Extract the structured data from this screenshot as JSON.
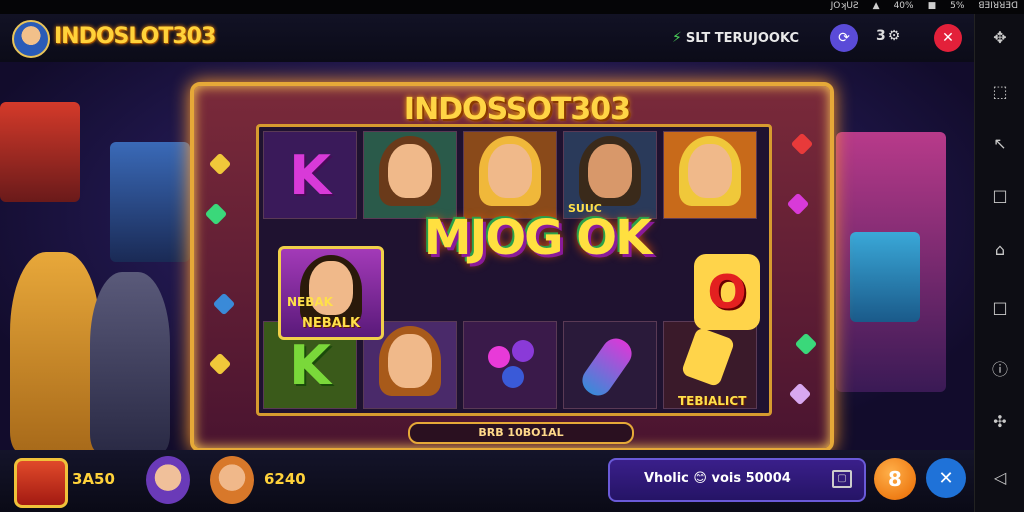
{
  "status_bar": {
    "items": [
      "JOʞUƧ",
      "▲",
      "40%",
      "■",
      "5%",
      "ꓭƎIꓤꓤƎꓷ"
    ]
  },
  "header": {
    "brand": "INDOSLOT303",
    "status_text": "SLT TERUJOOKC",
    "gear_count": "3"
  },
  "game": {
    "frame_title": "INDOSSOT303",
    "win_text": "MJOG OK",
    "wild_label": "NEBALK",
    "wild_sub": "NEBAK",
    "o_symbol": "O",
    "k_symbol": "K",
    "bonus_label": "TEBIALICT",
    "bottom_text": "BRB 10BO1AL",
    "badge_text": "SUUC"
  },
  "bottom": {
    "value_1": "3A50",
    "value_2": "6240",
    "wallet_text": "Vholic 😊 vois 50004",
    "coin_label": "8",
    "close_label": "✕"
  },
  "side_panel": {
    "icons": [
      "scatter-icon",
      "frame-icon",
      "arrow-icon",
      "square-icon",
      "home-icon",
      "window-icon",
      "info-icon",
      "puzzle-icon",
      "back-icon"
    ]
  },
  "colors": {
    "brand": "#ffd23a",
    "accent": "#e6a938",
    "danger": "#e3203a",
    "primary": "#1f72d8"
  }
}
